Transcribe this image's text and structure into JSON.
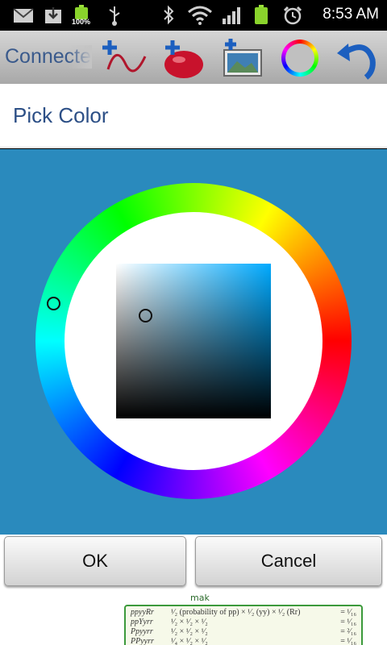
{
  "status_bar": {
    "time": "8:53 AM",
    "battery_percent_label": "100%",
    "icons": [
      "gmail-icon",
      "download-icon",
      "battery-icon",
      "usb-icon",
      "bluetooth-icon",
      "wifi-icon",
      "signal-icon",
      "battery-icon",
      "alarm-icon"
    ]
  },
  "toolbar": {
    "title": "Connecte",
    "buttons": [
      "add-wave-icon",
      "add-blob-icon",
      "add-image-icon",
      "color-ring-icon",
      "undo-icon"
    ]
  },
  "dialog": {
    "title": "Pick Color",
    "ok_label": "OK",
    "cancel_label": "Cancel"
  },
  "colors": {
    "dialog_body": "#2a8abd",
    "title_text": "#2c4f86",
    "square_hue": "#00aaff"
  },
  "background_notes": {
    "handwritten": "mak",
    "rows": [
      [
        "ppyyRr",
        "¹⁄₂ (probability of pp) × ¹⁄₂ (yy) × ¹⁄₂ (Rr)",
        "= ¹⁄₁₆"
      ],
      [
        "ppYyrr",
        "¹⁄₂ × ¹⁄₂ × ¹⁄₂",
        "= ¹⁄₁₆"
      ],
      [
        "Ppyyrr",
        "¹⁄₂ × ¹⁄₂ × ¹⁄₂",
        "= ²⁄₁₆"
      ],
      [
        "PPyyrr",
        "¹⁄₄ × ¹⁄₂ × ¹⁄₂",
        "= ¹⁄₁₆"
      ]
    ]
  }
}
